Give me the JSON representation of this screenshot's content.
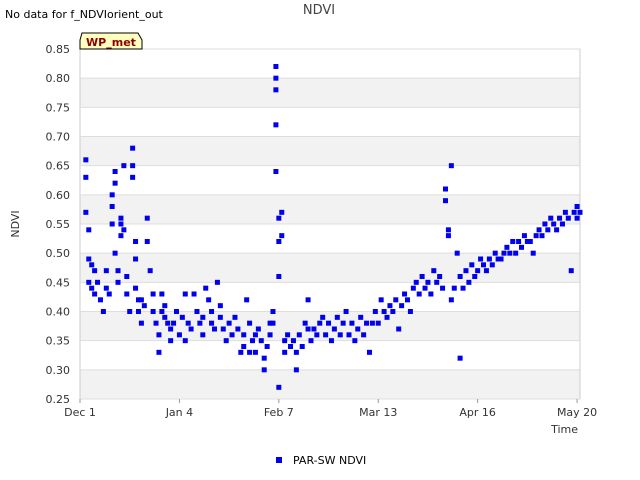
{
  "status_message": "No data for f_NDVIorient_out",
  "site_badge": "WP_met",
  "colors": {
    "series": "#0000ee",
    "band": "#f2f2f2",
    "grid": "#dddddd",
    "badge_fill": "#ffffc0",
    "badge_text": "#8b0000"
  },
  "chart_data": {
    "type": "scatter",
    "title": "NDVI",
    "xlabel": "Time",
    "ylabel": "NDVI",
    "x_domain_days": [
      0,
      171
    ],
    "xticks": [
      {
        "label": "Dec 1",
        "day": 0
      },
      {
        "label": "Jan 4",
        "day": 34
      },
      {
        "label": "Feb 7",
        "day": 68
      },
      {
        "label": "Mar 13",
        "day": 102
      },
      {
        "label": "Apr 16",
        "day": 136
      },
      {
        "label": "May 20",
        "day": 170
      }
    ],
    "ylim": [
      0.25,
      0.85
    ],
    "yticks": [
      "0.25",
      "0.30",
      "0.35",
      "0.40",
      "0.45",
      "0.50",
      "0.55",
      "0.60",
      "0.65",
      "0.70",
      "0.75",
      "0.80",
      "0.85"
    ],
    "legend_position": "bottom-center",
    "series": [
      {
        "name": "PAR-SW NDVI",
        "points": [
          [
            2,
            0.66
          ],
          [
            2,
            0.63
          ],
          [
            2,
            0.57
          ],
          [
            3,
            0.54
          ],
          [
            3,
            0.49
          ],
          [
            3,
            0.45
          ],
          [
            4,
            0.48
          ],
          [
            4,
            0.44
          ],
          [
            5,
            0.47
          ],
          [
            5,
            0.43
          ],
          [
            6,
            0.45
          ],
          [
            7,
            0.42
          ],
          [
            8,
            0.4
          ],
          [
            9,
            0.47
          ],
          [
            9,
            0.44
          ],
          [
            10,
            0.43
          ],
          [
            11,
            0.6
          ],
          [
            11,
            0.58
          ],
          [
            11,
            0.55
          ],
          [
            12,
            0.64
          ],
          [
            12,
            0.62
          ],
          [
            12,
            0.5
          ],
          [
            13,
            0.47
          ],
          [
            13,
            0.45
          ],
          [
            14,
            0.56
          ],
          [
            14,
            0.55
          ],
          [
            14,
            0.53
          ],
          [
            15,
            0.65
          ],
          [
            15,
            0.54
          ],
          [
            16,
            0.46
          ],
          [
            16,
            0.43
          ],
          [
            17,
            0.4
          ],
          [
            18,
            0.68
          ],
          [
            18,
            0.65
          ],
          [
            18,
            0.63
          ],
          [
            19,
            0.52
          ],
          [
            19,
            0.49
          ],
          [
            19,
            0.44
          ],
          [
            20,
            0.42
          ],
          [
            20,
            0.4
          ],
          [
            21,
            0.42
          ],
          [
            21,
            0.38
          ],
          [
            22,
            0.41
          ],
          [
            23,
            0.56
          ],
          [
            23,
            0.52
          ],
          [
            24,
            0.47
          ],
          [
            25,
            0.43
          ],
          [
            25,
            0.4
          ],
          [
            26,
            0.38
          ],
          [
            27,
            0.36
          ],
          [
            27,
            0.33
          ],
          [
            28,
            0.43
          ],
          [
            28,
            0.4
          ],
          [
            29,
            0.39
          ],
          [
            29,
            0.41
          ],
          [
            30,
            0.38
          ],
          [
            31,
            0.37
          ],
          [
            31,
            0.35
          ],
          [
            32,
            0.38
          ],
          [
            33,
            0.4
          ],
          [
            34,
            0.36
          ],
          [
            35,
            0.39
          ],
          [
            36,
            0.35
          ],
          [
            37,
            0.38
          ],
          [
            38,
            0.37
          ],
          [
            39,
            0.43
          ],
          [
            40,
            0.4
          ],
          [
            41,
            0.38
          ],
          [
            42,
            0.36
          ],
          [
            42,
            0.39
          ],
          [
            43,
            0.44
          ],
          [
            44,
            0.42
          ],
          [
            45,
            0.4
          ],
          [
            45,
            0.38
          ],
          [
            46,
            0.37
          ],
          [
            47,
            0.45
          ],
          [
            48,
            0.41
          ],
          [
            48,
            0.39
          ],
          [
            49,
            0.37
          ],
          [
            50,
            0.35
          ],
          [
            51,
            0.38
          ],
          [
            52,
            0.36
          ],
          [
            53,
            0.39
          ],
          [
            54,
            0.37
          ],
          [
            55,
            0.33
          ],
          [
            56,
            0.36
          ],
          [
            56,
            0.34
          ],
          [
            57,
            0.42
          ],
          [
            58,
            0.38
          ],
          [
            59,
            0.35
          ],
          [
            60,
            0.36
          ],
          [
            60,
            0.33
          ],
          [
            61,
            0.37
          ],
          [
            62,
            0.35
          ],
          [
            63,
            0.32
          ],
          [
            63,
            0.3
          ],
          [
            64,
            0.34
          ],
          [
            65,
            0.38
          ],
          [
            65,
            0.36
          ],
          [
            66,
            0.4
          ],
          [
            66,
            0.38
          ],
          [
            67,
            0.72
          ],
          [
            67,
            0.64
          ],
          [
            67,
            0.82
          ],
          [
            67,
            0.8
          ],
          [
            67,
            0.78
          ],
          [
            68,
            0.46
          ],
          [
            68,
            0.52
          ],
          [
            68,
            0.56
          ],
          [
            69,
            0.57
          ],
          [
            69,
            0.53
          ],
          [
            68,
            0.27
          ],
          [
            70,
            0.35
          ],
          [
            70,
            0.33
          ],
          [
            71,
            0.36
          ],
          [
            72,
            0.34
          ],
          [
            73,
            0.35
          ],
          [
            74,
            0.3
          ],
          [
            74,
            0.33
          ],
          [
            75,
            0.36
          ],
          [
            76,
            0.34
          ],
          [
            77,
            0.38
          ],
          [
            78,
            0.42
          ],
          [
            78,
            0.37
          ],
          [
            79,
            0.35
          ],
          [
            80,
            0.37
          ],
          [
            81,
            0.36
          ],
          [
            82,
            0.38
          ],
          [
            83,
            0.39
          ],
          [
            84,
            0.36
          ],
          [
            85,
            0.38
          ],
          [
            86,
            0.35
          ],
          [
            87,
            0.37
          ],
          [
            88,
            0.39
          ],
          [
            89,
            0.36
          ],
          [
            90,
            0.38
          ],
          [
            91,
            0.4
          ],
          [
            92,
            0.36
          ],
          [
            93,
            0.38
          ],
          [
            94,
            0.35
          ],
          [
            95,
            0.37
          ],
          [
            96,
            0.39
          ],
          [
            97,
            0.36
          ],
          [
            98,
            0.38
          ],
          [
            99,
            0.33
          ],
          [
            100,
            0.38
          ],
          [
            101,
            0.4
          ],
          [
            102,
            0.38
          ],
          [
            103,
            0.42
          ],
          [
            104,
            0.4
          ],
          [
            105,
            0.39
          ],
          [
            106,
            0.41
          ],
          [
            107,
            0.4
          ],
          [
            108,
            0.42
          ],
          [
            109,
            0.37
          ],
          [
            110,
            0.41
          ],
          [
            111,
            0.43
          ],
          [
            112,
            0.42
          ],
          [
            113,
            0.4
          ],
          [
            114,
            0.44
          ],
          [
            115,
            0.45
          ],
          [
            116,
            0.43
          ],
          [
            117,
            0.46
          ],
          [
            118,
            0.44
          ],
          [
            119,
            0.45
          ],
          [
            120,
            0.43
          ],
          [
            121,
            0.47
          ],
          [
            122,
            0.45
          ],
          [
            123,
            0.46
          ],
          [
            124,
            0.44
          ],
          [
            125,
            0.61
          ],
          [
            125,
            0.59
          ],
          [
            126,
            0.54
          ],
          [
            126,
            0.53
          ],
          [
            127,
            0.65
          ],
          [
            127,
            0.42
          ],
          [
            128,
            0.44
          ],
          [
            129,
            0.5
          ],
          [
            130,
            0.46
          ],
          [
            131,
            0.44
          ],
          [
            132,
            0.47
          ],
          [
            133,
            0.45
          ],
          [
            134,
            0.48
          ],
          [
            135,
            0.46
          ],
          [
            136,
            0.47
          ],
          [
            137,
            0.49
          ],
          [
            138,
            0.48
          ],
          [
            139,
            0.47
          ],
          [
            140,
            0.49
          ],
          [
            141,
            0.48
          ],
          [
            142,
            0.5
          ],
          [
            143,
            0.49
          ],
          [
            144,
            0.49
          ],
          [
            145,
            0.5
          ],
          [
            146,
            0.51
          ],
          [
            147,
            0.5
          ],
          [
            148,
            0.52
          ],
          [
            149,
            0.5
          ],
          [
            150,
            0.52
          ],
          [
            151,
            0.51
          ],
          [
            152,
            0.53
          ],
          [
            153,
            0.52
          ],
          [
            154,
            0.52
          ],
          [
            155,
            0.5
          ],
          [
            156,
            0.53
          ],
          [
            157,
            0.54
          ],
          [
            158,
            0.53
          ],
          [
            159,
            0.55
          ],
          [
            160,
            0.54
          ],
          [
            161,
            0.56
          ],
          [
            162,
            0.55
          ],
          [
            163,
            0.54
          ],
          [
            164,
            0.56
          ],
          [
            165,
            0.55
          ],
          [
            166,
            0.57
          ],
          [
            167,
            0.56
          ],
          [
            168,
            0.47
          ],
          [
            169,
            0.57
          ],
          [
            170,
            0.58
          ],
          [
            170,
            0.56
          ],
          [
            171,
            0.57
          ],
          [
            130,
            0.32
          ],
          [
            36,
            0.43
          ],
          [
            58,
            0.33
          ]
        ]
      }
    ]
  }
}
